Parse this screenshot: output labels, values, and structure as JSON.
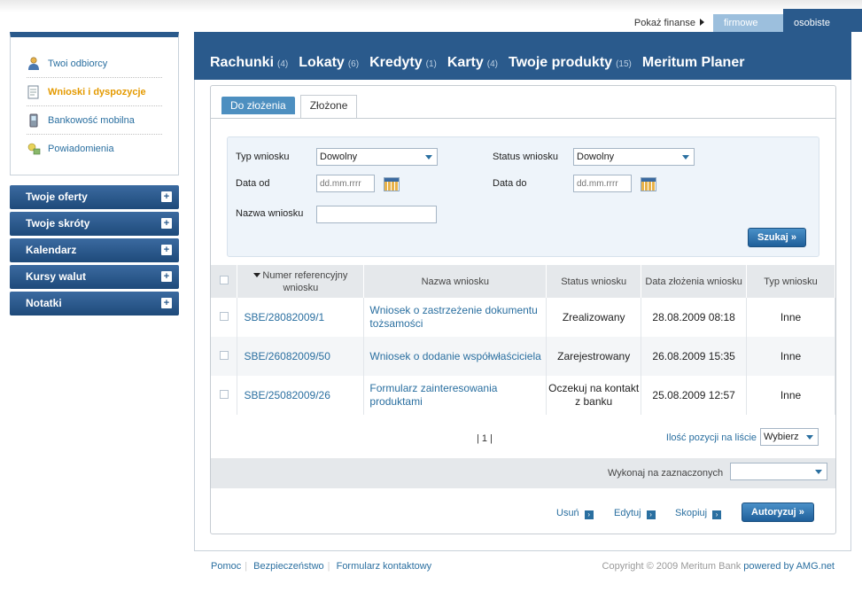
{
  "finance": {
    "label": "Pokaż finanse",
    "tabs": [
      "firmowe",
      "osobiste"
    ]
  },
  "sidebar": {
    "items": [
      {
        "label": "Twoi odbiorcy",
        "icon": "person-icon"
      },
      {
        "label": "Wnioski i dyspozycje",
        "icon": "document-icon",
        "active": true
      },
      {
        "label": "Bankowość mobilna",
        "icon": "phone-icon"
      },
      {
        "label": "Powiadomienia",
        "icon": "bell-icon"
      }
    ],
    "panels": [
      "Twoje oferty",
      "Twoje skróty",
      "Kalendarz",
      "Kursy walut",
      "Notatki"
    ]
  },
  "nav": [
    {
      "label": "Rachunki",
      "count": "(4)"
    },
    {
      "label": "Lokaty",
      "count": "(6)"
    },
    {
      "label": "Kredyty",
      "count": "(1)"
    },
    {
      "label": "Karty",
      "count": "(4)"
    },
    {
      "label": "Twoje produkty",
      "count": "(15)"
    },
    {
      "label": "Meritum Planer",
      "count": ""
    }
  ],
  "subtabs": [
    "Do złożenia",
    "Złożone"
  ],
  "search": {
    "type_label": "Typ wniosku",
    "type_value": "Dowolny",
    "status_label": "Status wniosku",
    "status_value": "Dowolny",
    "date_from_label": "Data od",
    "date_from_placeholder": "dd.mm.rrrr",
    "date_to_label": "Data do",
    "date_to_placeholder": "dd.mm.rrrr",
    "name_label": "Nazwa wniosku",
    "search_button": "Szukaj »"
  },
  "table": {
    "headers": [
      "Numer referencyjny wniosku",
      "Nazwa wniosku",
      "Status wniosku",
      "Data złożenia wniosku",
      "Typ wniosku"
    ],
    "rows": [
      {
        "ref": "SBE/28082009/1",
        "name": "Wniosek o zastrzeżenie dokumentu tożsamości",
        "status": "Zrealizowany",
        "date": "28.08.2009 08:18",
        "type": "Inne"
      },
      {
        "ref": "SBE/26082009/50",
        "name": "Wniosek o dodanie współwłaściciela",
        "status": "Zarejestrowany",
        "date": "26.08.2009 15:35",
        "type": "Inne"
      },
      {
        "ref": "SBE/25082009/26",
        "name": "Formularz zainteresowania produktami",
        "status": "Oczekuj na kontakt z banku",
        "date": "25.08.2009 12:57",
        "type": "Inne"
      }
    ]
  },
  "pager": {
    "text": "| 1 |"
  },
  "per_page": {
    "label": "Ilość pozycji na liście",
    "value": "Wybierz"
  },
  "bulk": {
    "label": "Wykonaj na zaznaczonych",
    "value": ""
  },
  "actions": {
    "delete": "Usuń",
    "edit": "Edytuj",
    "copy": "Skopiuj",
    "authorize": "Autoryzuj »"
  },
  "footer": {
    "links": [
      "Pomoc",
      "Bezpieczeństwo",
      "Formularz kontaktowy"
    ],
    "copyright": "Copyright © 2009 Meritum Bank",
    "powered": "powered by AMG.net"
  },
  "colors": {
    "brand": "#2a5a8c",
    "link": "#2a6fa0",
    "active": "#e49a00"
  }
}
